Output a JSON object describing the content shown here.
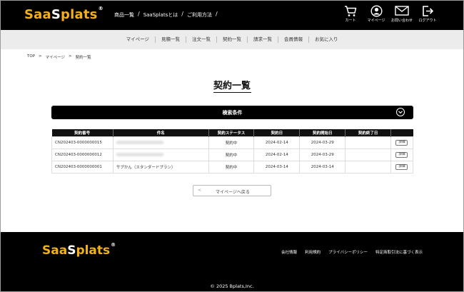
{
  "header": {
    "logo_a": "Saa",
    "logo_b": "S",
    "logo_c": "plats",
    "logo_reg": "®",
    "nav": [
      "商品一覧",
      "SaaSplatsとは",
      "ご利用方法"
    ],
    "nav_sep": "/",
    "icons": [
      {
        "icon": "cart-icon",
        "label": "カート"
      },
      {
        "icon": "user-icon",
        "label": "マイページ"
      },
      {
        "icon": "mail-icon",
        "label": "お問い合わせ"
      },
      {
        "icon": "logout-icon",
        "label": "ログアウト"
      }
    ]
  },
  "subnav": [
    "マイページ",
    "見積一覧",
    "注文一覧",
    "契約一覧",
    "請求一覧",
    "会員情報",
    "お気に入り"
  ],
  "breadcrumb": {
    "items": [
      "TOP",
      "マイページ",
      "契約一覧"
    ],
    "sep": ">"
  },
  "page_title": "契約一覧",
  "search": {
    "label": "検索条件"
  },
  "table": {
    "headers": [
      "契約番号",
      "件名",
      "契約ステータス",
      "契約日",
      "契約開始日",
      "契約終了日",
      ""
    ],
    "rows": [
      {
        "no": "CN202403-0000000015",
        "name": "",
        "status": "契約中",
        "date": "2024-02-14",
        "start": "2024-03-29",
        "end": "",
        "btn": "詳細"
      },
      {
        "no": "CN202403-0000000012",
        "name": "",
        "status": "契約中",
        "date": "2024-02-14",
        "start": "2024-03-29",
        "end": "",
        "btn": "詳細"
      },
      {
        "no": "CN202403-0000000001",
        "name": "サブかん（スタンダードプラン）",
        "status": "契約中",
        "date": "2024-03-14",
        "start": "2024-03-14",
        "end": "",
        "btn": "詳細"
      }
    ]
  },
  "back_button": "マイページへ戻る",
  "back_arrow": "<",
  "footer": {
    "links": [
      "会社情報",
      "利用規約",
      "プライバシーポリシー",
      "特定商取引法に基づく表示"
    ],
    "copyright": "© 2025 Bplats,Inc."
  },
  "colors": {
    "accent": "#f2b01e",
    "dark": "#000000",
    "subnav_bg": "#ececec"
  }
}
